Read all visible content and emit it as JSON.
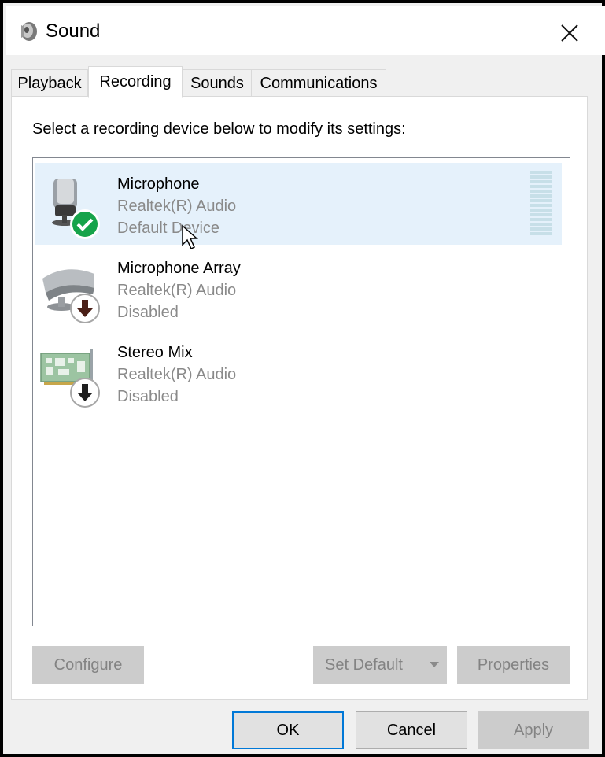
{
  "window": {
    "title": "Sound"
  },
  "tabs": [
    {
      "label": "Playback",
      "active": false
    },
    {
      "label": "Recording",
      "active": true
    },
    {
      "label": "Sounds",
      "active": false
    },
    {
      "label": "Communications",
      "active": false
    }
  ],
  "recording": {
    "instruction": "Select a recording device below to modify its settings:",
    "devices": [
      {
        "name": "Microphone",
        "driver": "Realtek(R) Audio",
        "status": "Default Device",
        "icon": "microphone-icon",
        "badge": "check-badge-icon",
        "selected": true
      },
      {
        "name": "Microphone Array",
        "driver": "Realtek(R) Audio",
        "status": "Disabled",
        "icon": "microphone-array-icon",
        "badge": "down-arrow-badge-icon",
        "selected": false
      },
      {
        "name": "Stereo Mix",
        "driver": "Realtek(R) Audio",
        "status": "Disabled",
        "icon": "sound-card-icon",
        "badge": "down-arrow-badge-icon",
        "selected": false
      }
    ]
  },
  "buttons": {
    "configure": "Configure",
    "set_default": "Set Default",
    "properties": "Properties",
    "ok": "OK",
    "cancel": "Cancel",
    "apply": "Apply"
  },
  "colors": {
    "selection": "#e5f1fb",
    "accent": "#0078d7",
    "check_badge": "#16a34a",
    "disabled_text": "#838383"
  }
}
